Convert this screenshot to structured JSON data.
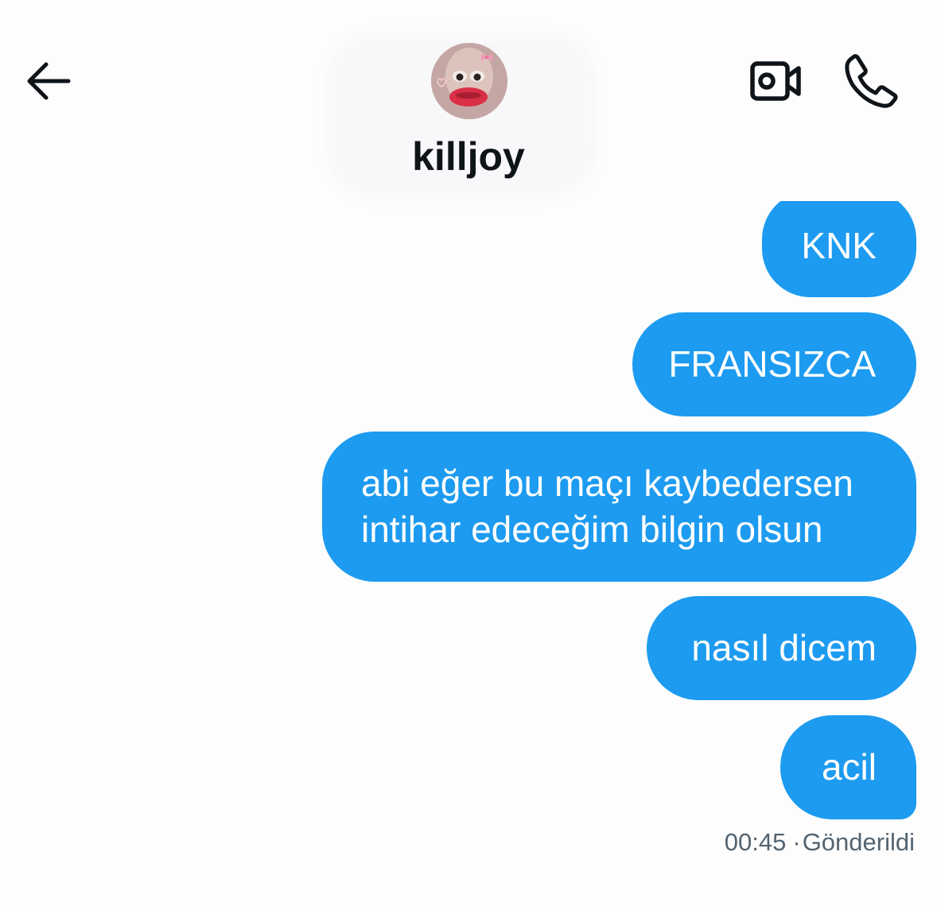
{
  "header": {
    "username": "killjoy",
    "back_icon": "arrow-left-icon",
    "video_icon": "video-camera-icon",
    "call_icon": "phone-icon"
  },
  "messages": [
    {
      "text": "KNK"
    },
    {
      "text": "FRANSIZCA"
    },
    {
      "text": "abi eğer bu maçı kaybedersen intihar edeceğim bilgin olsun"
    },
    {
      "text": "nasıl dicem"
    },
    {
      "text": "acil"
    }
  ],
  "status": {
    "time": "00:45",
    "separator": "·",
    "label": "Gönderildi"
  },
  "colors": {
    "bubble": "#1d9bf0",
    "bubble_text": "#ffffff",
    "title": "#0f1419",
    "meta": "#536471"
  }
}
